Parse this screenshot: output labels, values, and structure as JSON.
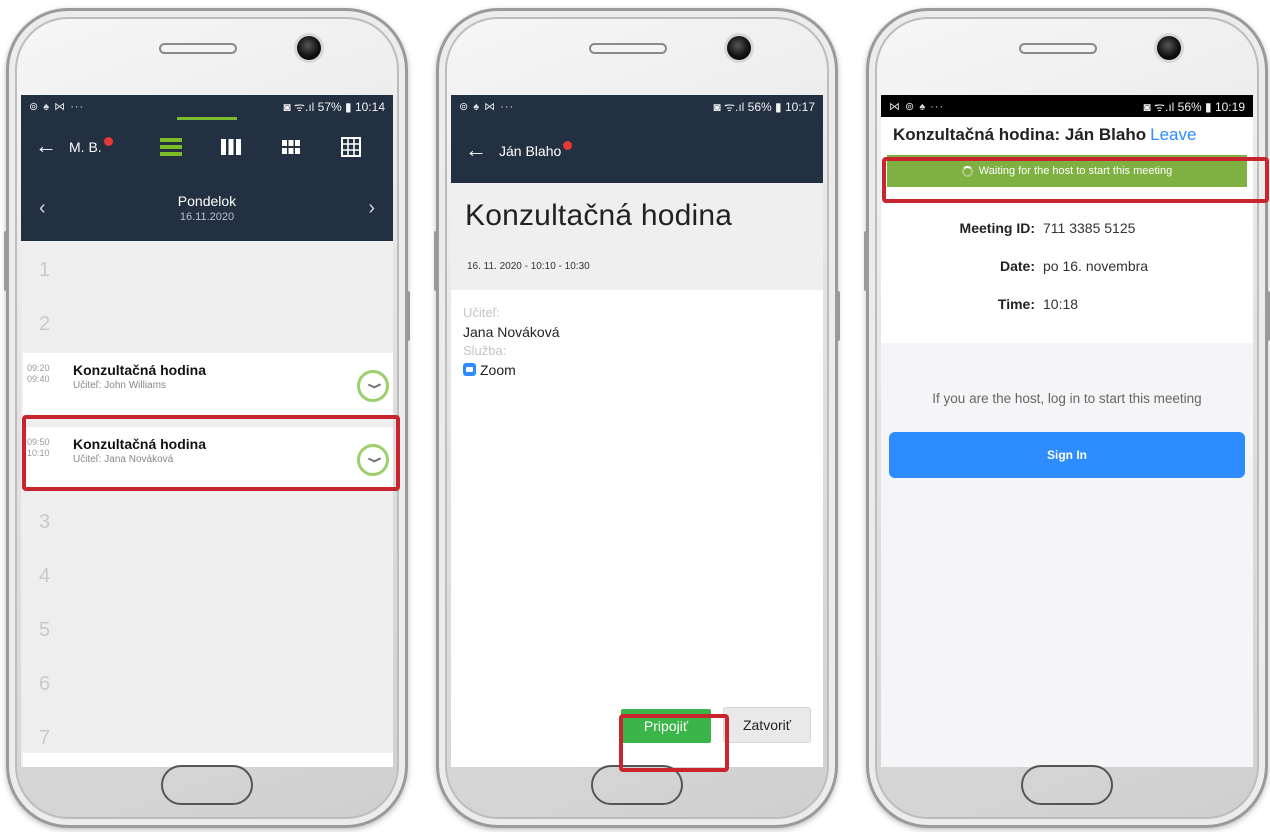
{
  "phone1": {
    "status": {
      "left": "⊚ ♠ ⋈ ···",
      "right": "◙ ᯤ.ıl 57% ▮ 10:14"
    },
    "user": "M. B.",
    "view_icons": [
      "list-view-icon",
      "week-view-icon",
      "grid-small-icon",
      "grid-large-icon"
    ],
    "day": "Pondelok",
    "date": "16.11.2020",
    "row_numbers": [
      "1",
      "2",
      "3",
      "4",
      "5",
      "6",
      "7"
    ],
    "events": [
      {
        "start": "09:20",
        "end": "09:40",
        "title": "Konzultačná hodina",
        "teacher": "Učiteľ: John Williams"
      },
      {
        "start": "09:50",
        "end": "10:10",
        "title": "Konzultačná hodina",
        "teacher": "Učiteľ: Jana Nováková"
      }
    ],
    "colors": {
      "header": "#233042",
      "accent": "#7bbd2a",
      "highlight": "#c8252f"
    }
  },
  "phone2": {
    "status": {
      "left": "⊚ ♠ ⋈ ···",
      "right": "◙ ᯤ.ıl 56% ▮ 10:17"
    },
    "user": "Ján Blaho",
    "title": "Konzultačná hodina",
    "datetime": "16. 11. 2020 - 10:10 - 10:30",
    "teacher_label": "Učiteľ:",
    "teacher": "Jana Nováková",
    "service_label": "Služba:",
    "service": "Zoom",
    "join_label": "Pripojiť",
    "close_label": "Zatvoriť"
  },
  "phone3": {
    "status": {
      "left": "⋈ ⊚ ♠ ···",
      "right": "◙ ᯤ.ıl 56% ▮ 10:19"
    },
    "meeting_title": "Konzultačná hodina: Ján Blaho",
    "leave_label": "Leave",
    "waiting_text": "Waiting for the host to start this meeting",
    "meeting_id_label": "Meeting ID:",
    "meeting_id": "711 3385 5125",
    "date_label": "Date:",
    "date": "po 16. novembra",
    "time_label": "Time:",
    "time": "10:18",
    "host_message": "If you are the host, log in to start this meeting",
    "signin_label": "Sign In",
    "colors": {
      "waiting": "#7eb042",
      "signin": "#2d8cff"
    }
  }
}
